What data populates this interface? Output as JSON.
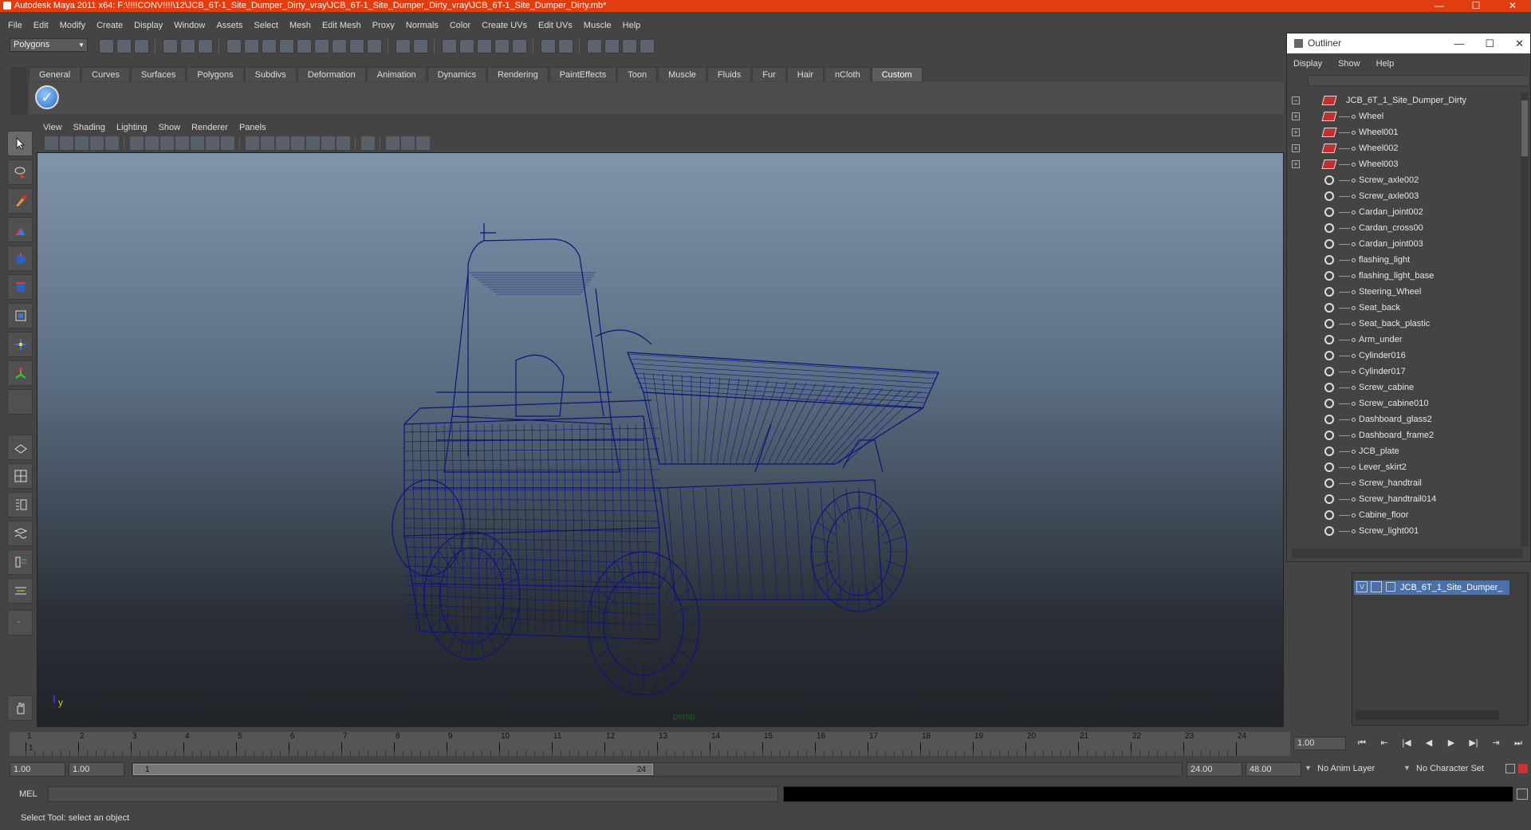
{
  "window": {
    "title": "Autodesk Maya 2011 x64: F:\\!!!!CONV!!!!\\12\\JCB_6T-1_Site_Dumper_Dirty_vray\\JCB_6T-1_Site_Dumper_Dirty_vray\\JCB_6T-1_Site_Dumper_Dirty.mb*",
    "minimize": "—",
    "maximize": "☐",
    "close": "✕"
  },
  "menu": [
    "File",
    "Edit",
    "Modify",
    "Create",
    "Display",
    "Window",
    "Assets",
    "Select",
    "Mesh",
    "Edit Mesh",
    "Proxy",
    "Normals",
    "Color",
    "Create UVs",
    "Edit UVs",
    "Muscle",
    "Help"
  ],
  "toolbar": {
    "mode": "Polygons"
  },
  "shelf": {
    "tabs": [
      "General",
      "Curves",
      "Surfaces",
      "Polygons",
      "Subdivs",
      "Deformation",
      "Animation",
      "Dynamics",
      "Rendering",
      "PaintEffects",
      "Toon",
      "Muscle",
      "Fluids",
      "Fur",
      "Hair",
      "nCloth",
      "Custom"
    ],
    "active_tab": "Custom"
  },
  "panel": {
    "menu": [
      "View",
      "Shading",
      "Lighting",
      "Show",
      "Renderer",
      "Panels"
    ],
    "camera_label": "persp",
    "axis_y": "y",
    "axis_x": "x",
    "wire_color": "#0d1478"
  },
  "outliner": {
    "title": "Outliner",
    "menu": [
      "Display",
      "Show",
      "Help"
    ],
    "root": "JCB_6T_1_Site_Dumper_Dirty",
    "items": [
      {
        "name": "Wheel",
        "type": "group"
      },
      {
        "name": "Wheel001",
        "type": "group"
      },
      {
        "name": "Wheel002",
        "type": "group"
      },
      {
        "name": "Wheel003",
        "type": "group"
      },
      {
        "name": "Screw_axle002",
        "type": "mesh"
      },
      {
        "name": "Screw_axle003",
        "type": "mesh"
      },
      {
        "name": "Cardan_joint002",
        "type": "mesh"
      },
      {
        "name": "Cardan_cross00",
        "type": "mesh"
      },
      {
        "name": "Cardan_joint003",
        "type": "mesh"
      },
      {
        "name": "flashing_light",
        "type": "mesh"
      },
      {
        "name": "flashing_light_base",
        "type": "mesh"
      },
      {
        "name": "Steering_Wheel",
        "type": "mesh"
      },
      {
        "name": "Seat_back",
        "type": "mesh"
      },
      {
        "name": "Seat_back_plastic",
        "type": "mesh"
      },
      {
        "name": "Arm_under",
        "type": "mesh"
      },
      {
        "name": "Cylinder016",
        "type": "mesh"
      },
      {
        "name": "Cylinder017",
        "type": "mesh"
      },
      {
        "name": "Screw_cabine",
        "type": "mesh"
      },
      {
        "name": "Screw_cabine010",
        "type": "mesh"
      },
      {
        "name": "Dashboard_glass2",
        "type": "mesh"
      },
      {
        "name": "Dashboard_frame2",
        "type": "mesh"
      },
      {
        "name": "JCB_plate",
        "type": "mesh"
      },
      {
        "name": "Lever_skirt2",
        "type": "mesh"
      },
      {
        "name": "Screw_handtrail",
        "type": "mesh"
      },
      {
        "name": "Screw_handtrail014",
        "type": "mesh"
      },
      {
        "name": "Cabine_floor",
        "type": "mesh"
      },
      {
        "name": "Screw_light001",
        "type": "mesh"
      }
    ]
  },
  "layers": {
    "visible_flag": "V",
    "layer_name": "JCB_6T_1_Site_Dumper_"
  },
  "timeline": {
    "ticks": [
      "1",
      "2",
      "3",
      "4",
      "5",
      "6",
      "7",
      "8",
      "9",
      "10",
      "11",
      "12",
      "13",
      "14",
      "15",
      "16",
      "17",
      "18",
      "19",
      "20",
      "21",
      "22",
      "23",
      "24"
    ],
    "current_frame_marker": "1",
    "current_frame": "1.00"
  },
  "range": {
    "start_time": "1.00",
    "start_playback": "1.00",
    "slider_start": "1",
    "slider_end": "24",
    "end_playback": "24.00",
    "end_time": "48.00",
    "anim_layer": "No Anim Layer",
    "character_set": "No Character Set"
  },
  "playback": [
    "⏮",
    "⇤",
    "|◀",
    "◀",
    "▶",
    "▶|",
    "⇥",
    "⏭"
  ],
  "command": {
    "label": "MEL"
  },
  "status": {
    "help": "Select Tool: select an object"
  }
}
